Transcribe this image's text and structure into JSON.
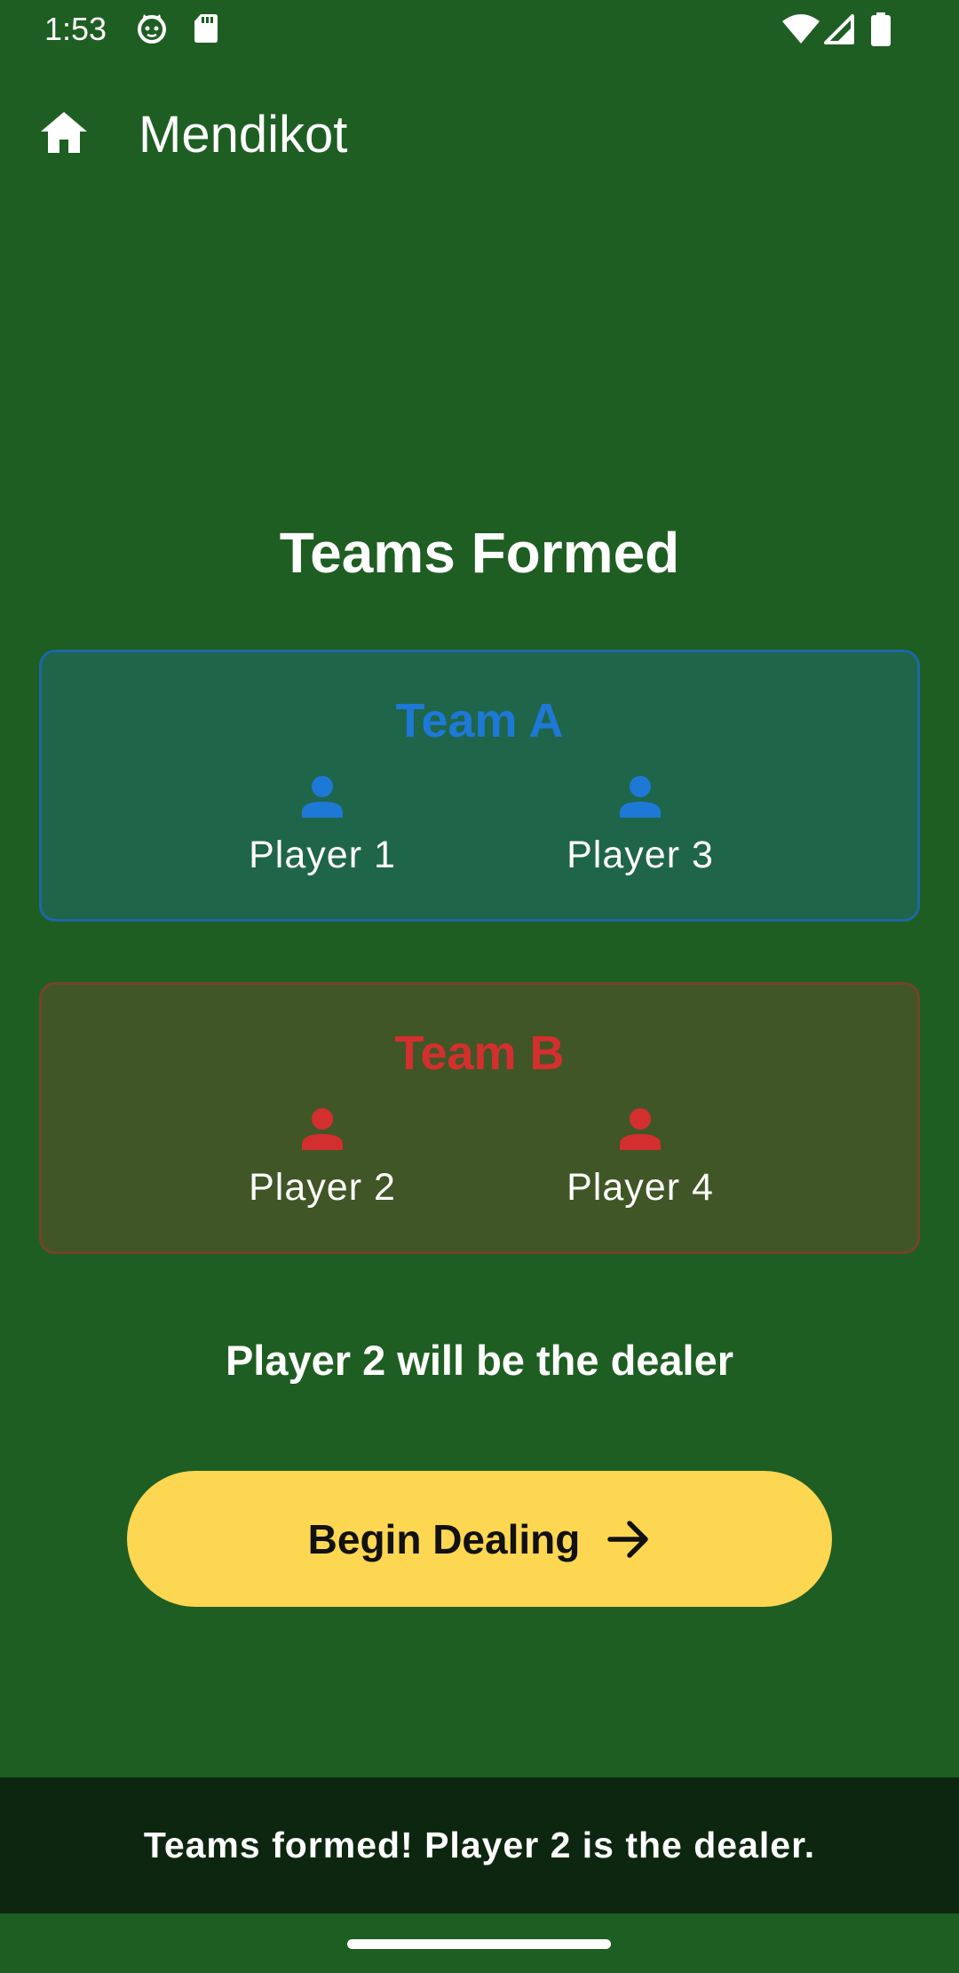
{
  "status_bar": {
    "time": "1:53",
    "icons": [
      "cat-notification-icon",
      "sd-card-icon",
      "wifi-icon",
      "signal-icon",
      "battery-icon"
    ]
  },
  "app_bar": {
    "title": "Mendikot",
    "home_icon": "home-icon"
  },
  "page": {
    "title": "Teams Formed"
  },
  "teams": [
    {
      "name": "Team A",
      "color": "#1e78d6",
      "players": [
        "Player 1",
        "Player 3"
      ]
    },
    {
      "name": "Team B",
      "color": "#d42f2f",
      "players": [
        "Player 2",
        "Player 4"
      ]
    }
  ],
  "dealer_message": "Player 2 will be the dealer",
  "action_button": {
    "label": "Begin Dealing",
    "icon": "arrow-right-icon",
    "color": "#fdd652"
  },
  "snackbar": {
    "message": "Teams formed! Player 2 is the dealer."
  }
}
